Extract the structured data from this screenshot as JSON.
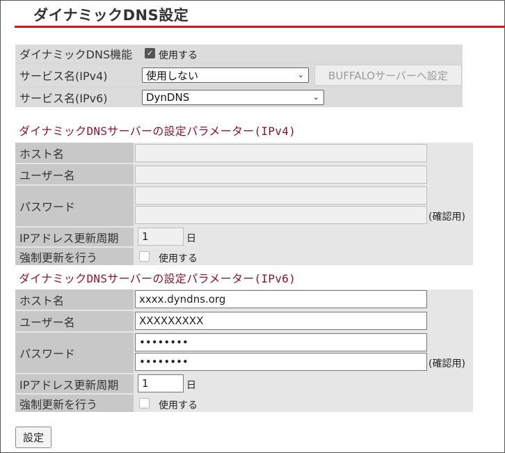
{
  "page": {
    "title": "ダイナミックDNS設定"
  },
  "general": {
    "function_label": "ダイナミックDNS機能",
    "function_checkbox_label": "使用する",
    "function_checked": true,
    "ipv4_service_label": "サービス名(IPv4)",
    "ipv4_service_value": "使用しない",
    "buffalo_button": "BUFFALOサーバーへ設定",
    "ipv6_service_label": "サービス名(IPv6)",
    "ipv6_service_value": "DynDNS"
  },
  "ipv4": {
    "section_title": "ダイナミックDNSサーバーの設定パラメーター(IPv4)",
    "host_label": "ホスト名",
    "host_value": "",
    "user_label": "ユーザー名",
    "user_value": "",
    "password_label": "パスワード",
    "password_value": "",
    "password_confirm_value": "",
    "confirm_suffix": "(確認用)",
    "period_label": "IPアドレス更新周期",
    "period_value": "1",
    "period_unit": "日",
    "force_label": "強制更新を行う",
    "force_checkbox_label": "使用する"
  },
  "ipv6": {
    "section_title": "ダイナミックDNSサーバーの設定パラメーター(IPv6)",
    "host_label": "ホスト名",
    "host_value": "xxxx.dyndns.org",
    "user_label": "ユーザー名",
    "user_value": "XXXXXXXXX",
    "password_label": "パスワード",
    "password_value": "••••••••",
    "password_confirm_value": "••••••••",
    "confirm_suffix": "(確認用)",
    "period_label": "IPアドレス更新周期",
    "period_value": "1",
    "period_unit": "日",
    "force_label": "強制更新を行う",
    "force_checkbox_label": "使用する"
  },
  "submit_label": "設定",
  "colors": {
    "accent_rule": "#d81414",
    "section_title": "#8a1530"
  }
}
